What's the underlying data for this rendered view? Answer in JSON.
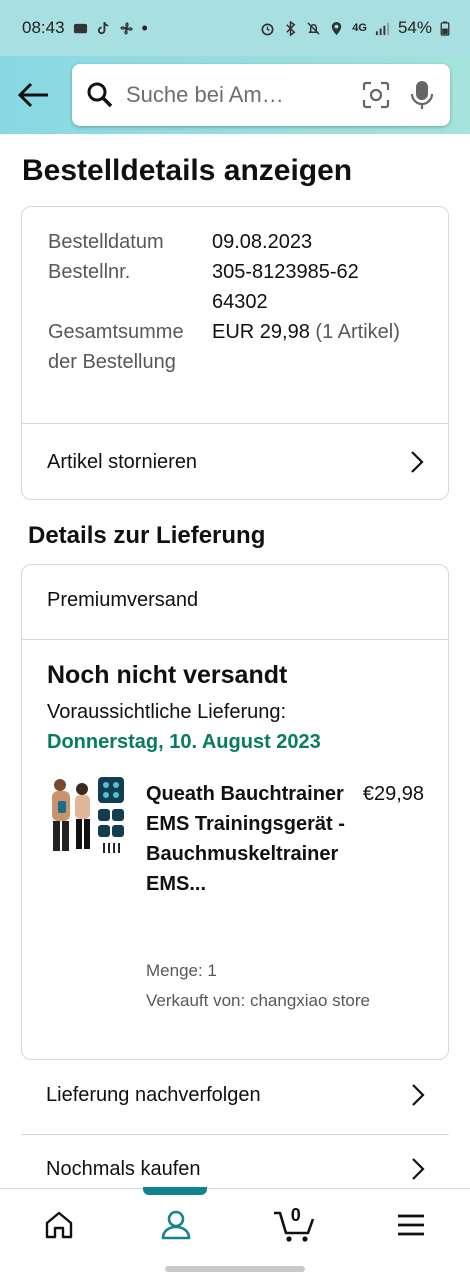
{
  "status_bar": {
    "time": "08:43",
    "battery": "54%",
    "network": "4G"
  },
  "header": {
    "search_placeholder": "Suche bei Am…"
  },
  "page_title": "Bestelldetails anzeigen",
  "order_summary": {
    "date_label": "Bestelldatum",
    "date_value": "09.08.2023",
    "number_label": "Bestellnr.",
    "number_value": "305-8123985-6264302",
    "total_label": "Gesamtsumme der Bestellung",
    "total_value": "EUR 29,98",
    "total_count": "(1 Artikel)",
    "cancel_link": "Artikel stornieren"
  },
  "delivery": {
    "heading": "Details zur Lieferung",
    "shipping_method": "Premiumversand",
    "status": "Noch nicht versandt",
    "eta_label": "Voraussichtliche Lieferung:",
    "eta_date": "Donnerstag, 10. August 2023",
    "product": {
      "title": "Queath Bauchtrainer EMS Trainingsgerät - Bauchmuskeltrainer EMS...",
      "price": "€29,98",
      "quantity": "Menge: 1",
      "seller": "Verkauft von: changxiao store"
    }
  },
  "actions": {
    "track": "Lieferung nachverfolgen",
    "buy_again": "Nochmals kaufen"
  },
  "bottom_nav": {
    "cart_count": "0",
    "active_tab": "account"
  },
  "colors": {
    "accent": "#11838e",
    "delivery_green": "#067d62",
    "header_gradient_start": "#88d8e3",
    "header_gradient_end": "#a5e2dc"
  }
}
